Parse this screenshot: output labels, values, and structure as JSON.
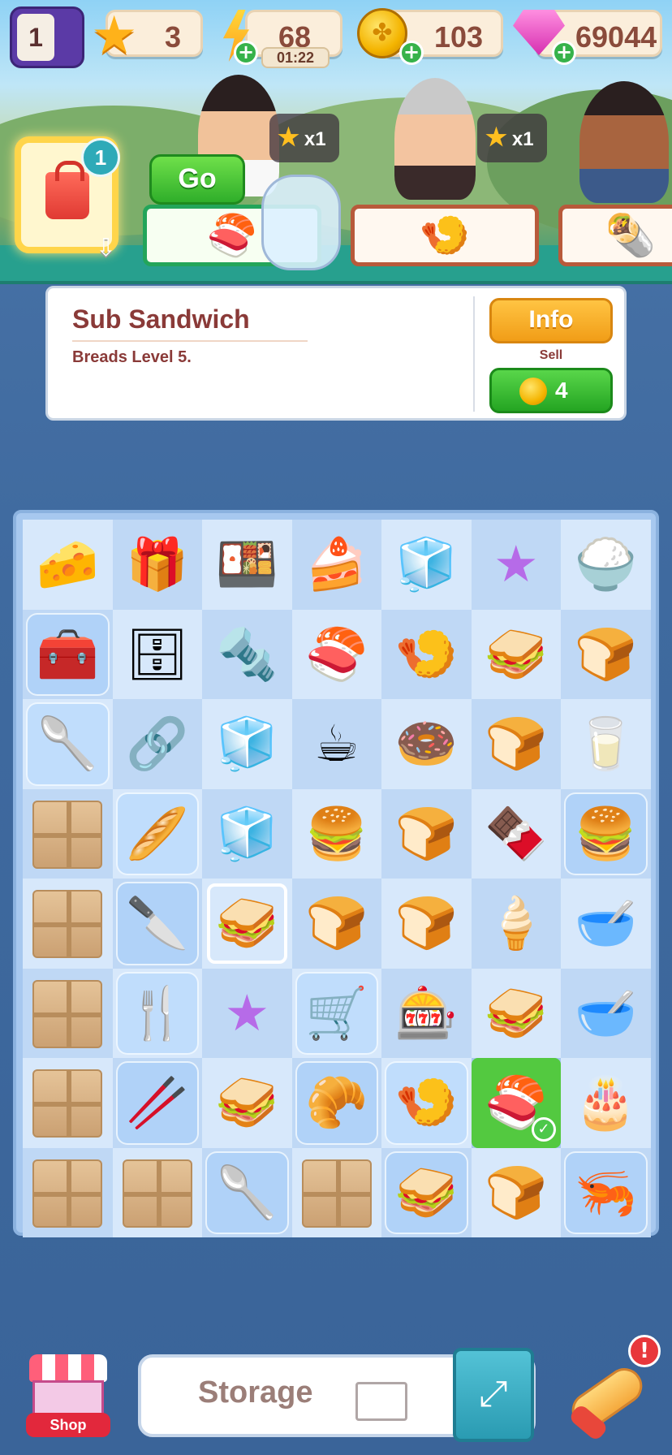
{
  "hud": {
    "level": "1",
    "stars": "3",
    "energy": "68",
    "energy_timer": "01:22",
    "coins": "103",
    "gems": "69044"
  },
  "customers": {
    "bag_count": "1",
    "go_label": "Go",
    "orders": [
      {
        "reward": "x1"
      },
      {
        "reward": "x1"
      }
    ]
  },
  "info_panel": {
    "item_name": "Sub Sandwich",
    "item_desc": "Breads Level 5.",
    "info_label": "Info",
    "sell_label": "Sell",
    "sell_price": "4"
  },
  "board": {
    "rows": [
      [
        "cheese",
        "gift-box",
        "sushi-bowl",
        "cake",
        "ice-tray",
        "star",
        "rice-bowl"
      ],
      [
        "ice-cooler",
        "drawer",
        "bolt-nut",
        "sushi-board",
        "nigiri",
        "sandwich",
        "bread"
      ],
      [
        "spatula",
        "handle",
        "ice-cube",
        "coffee-cup",
        "donut",
        "bread",
        "milk-jar"
      ],
      [
        "crate",
        "rolling-pin",
        "fridge",
        "burger",
        "bread",
        "chocolate",
        "burger"
      ],
      [
        "crate",
        "knife",
        "sub-sandwich",
        "bread",
        "bread",
        "ice-cream",
        "whisk-bowl"
      ],
      [
        "crate",
        "fork",
        "star",
        "cart",
        "machine",
        "sandwich",
        "mixer"
      ],
      [
        "crate",
        "tongs",
        "sub-sandwich",
        "croissant",
        "nigiri",
        "sushi-roll",
        "stand-mixer"
      ],
      [
        "crate",
        "crate",
        "ladle",
        "crate",
        "sub-sandwich",
        "bread",
        "shrimp"
      ]
    ]
  },
  "bottom": {
    "shop_label": "Shop",
    "storage_label": "Storage",
    "alert": "!"
  }
}
